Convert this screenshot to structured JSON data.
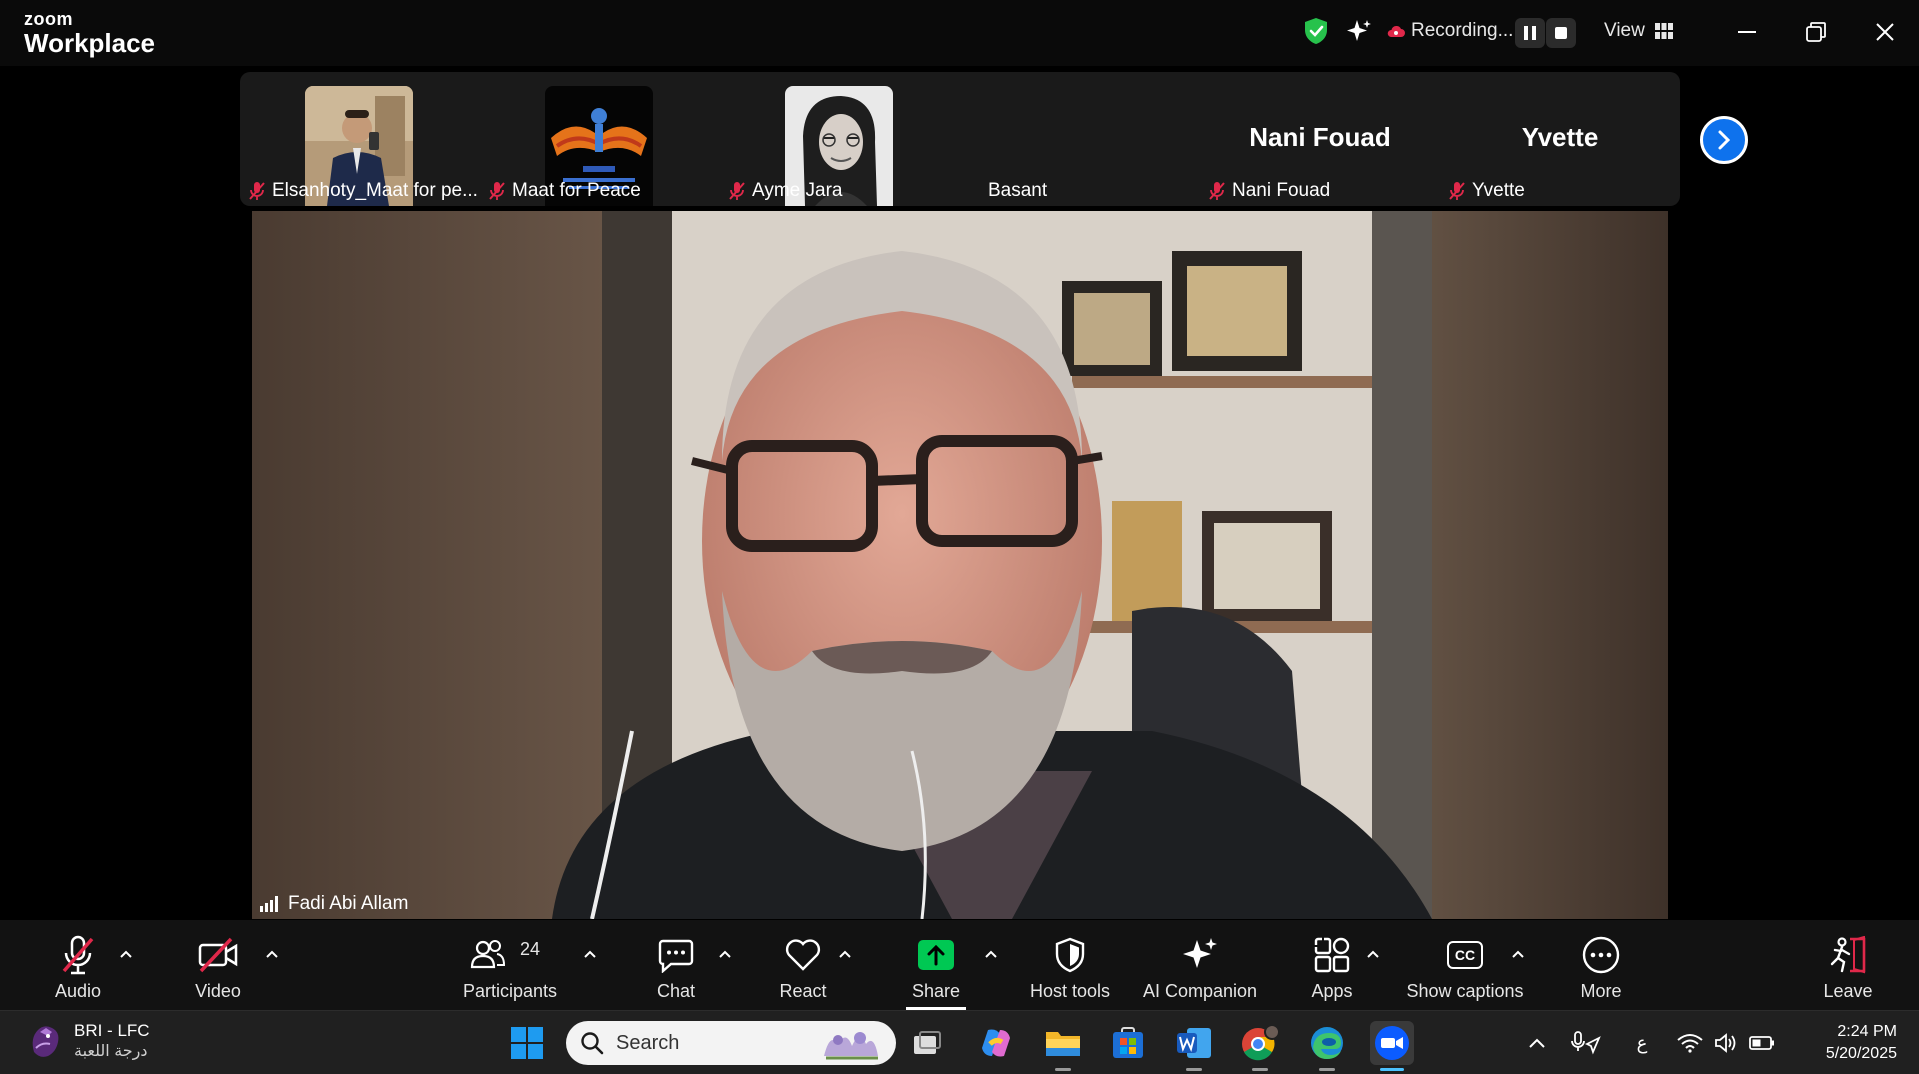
{
  "titlebar": {
    "brand_top": "zoom",
    "brand_bottom": "Workplace",
    "recording_label": "Recording...",
    "view_label": "View"
  },
  "thumbnails": [
    {
      "name": "Elsanhoty_Maat for pe...",
      "muted": true,
      "photo": "man-portrait"
    },
    {
      "name": "Maat for Peace",
      "muted": true,
      "photo": "maat-logo"
    },
    {
      "name": "Ayme Jara",
      "muted": true,
      "photo": "woman-portrait"
    },
    {
      "name": "Basant",
      "muted": false,
      "photo": "none"
    },
    {
      "name": "Nani Fouad",
      "muted": true,
      "display_name": "Nani Fouad"
    },
    {
      "name": "Yvette",
      "muted": true,
      "display_name": "Yvette"
    }
  ],
  "main_video": {
    "speaker": "Fadi Abi Allam"
  },
  "toolbar": {
    "audio": "Audio",
    "video": "Video",
    "participants": "Participants",
    "participants_count": "24",
    "chat": "Chat",
    "react": "React",
    "share": "Share",
    "host_tools": "Host tools",
    "ai_companion": "AI Companion",
    "apps": "Apps",
    "show_captions": "Show captions",
    "captions_icon_text": "CC",
    "more": "More",
    "leave": "Leave"
  },
  "taskbar": {
    "widget_title": "BRI - LFC",
    "widget_subtitle": "درجة اللعبة",
    "search_placeholder": "Search",
    "lang_indicator": "ع",
    "time": "2:24 PM",
    "date": "5/20/2025"
  },
  "colors": {
    "accent_blue": "#0e72ed",
    "share_green": "#00c853",
    "muted_red": "#e0284a",
    "shield_green": "#27c24c"
  }
}
